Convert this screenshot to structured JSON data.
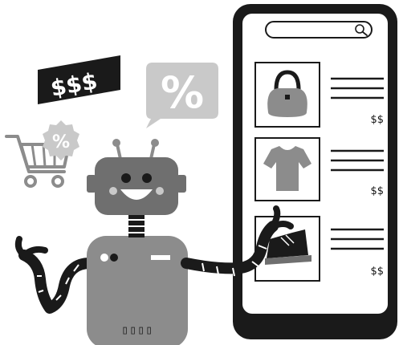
{
  "illustration": {
    "money_sign": "$$$",
    "percent_bubble": "%",
    "cart_badge": "%",
    "robot_label": "▯▯▯▯",
    "products": [
      {
        "icon": "handbag-icon",
        "price": "$$"
      },
      {
        "icon": "tshirt-icon",
        "price": "$$"
      },
      {
        "icon": "sneaker-icon",
        "price": "$$"
      }
    ]
  },
  "colors": {
    "dark": "#1a1a1a",
    "robot_gray": "#8c8c8c",
    "robot_dark": "#6f6f6f",
    "light_gray": "#c9c9c9",
    "white": "#ffffff"
  }
}
